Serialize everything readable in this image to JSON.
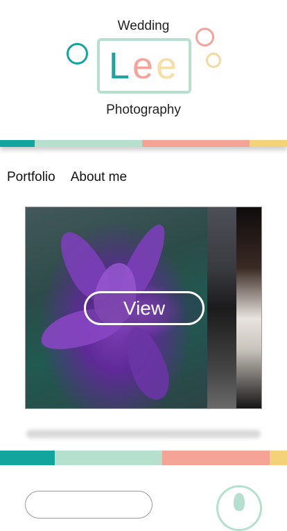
{
  "logo": {
    "top_text": "Wedding",
    "letters": [
      "L",
      "e",
      "e"
    ],
    "bottom_text": "Photography"
  },
  "nav": {
    "items": [
      {
        "label": "Portfolio"
      },
      {
        "label": "About me"
      }
    ]
  },
  "gallery": {
    "view_label": "View"
  },
  "colors": {
    "teal": "#12a59d",
    "mint": "#b5e0cd",
    "pink": "#f5a397",
    "yellow": "#f4d27a"
  }
}
